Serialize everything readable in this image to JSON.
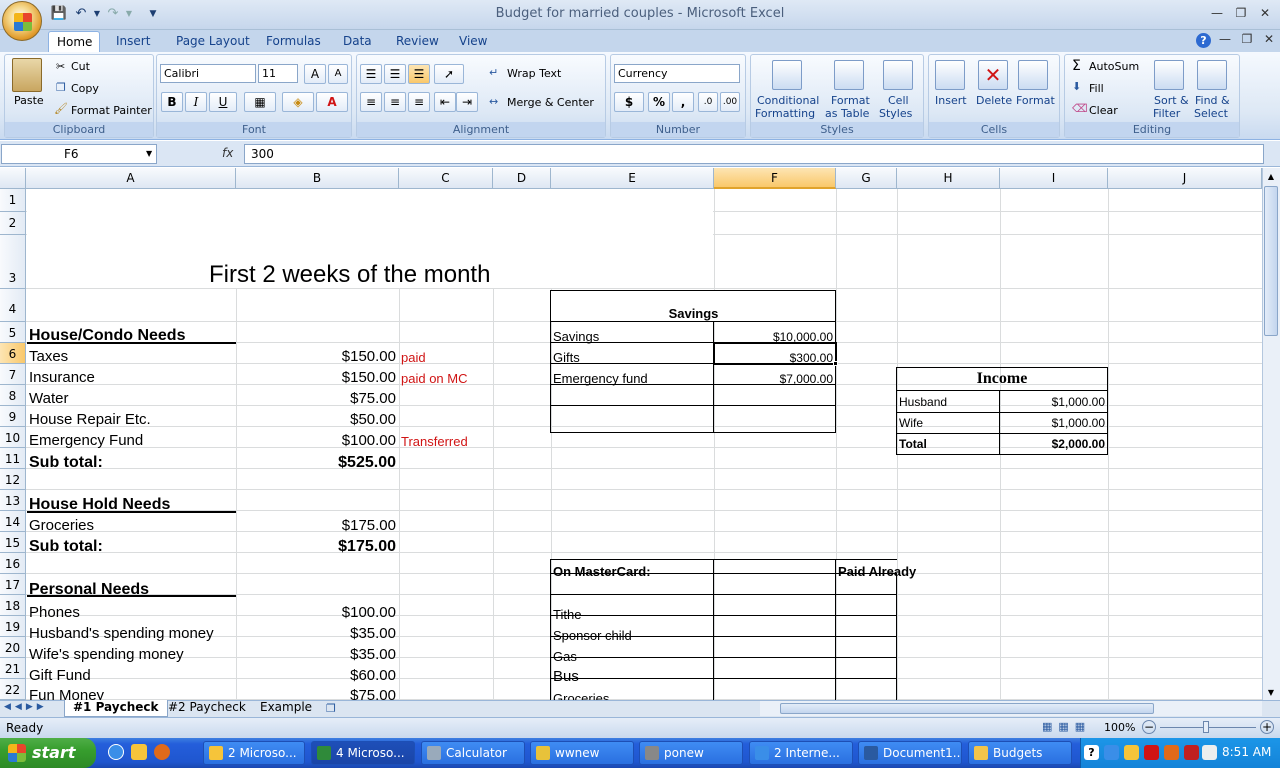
{
  "window": {
    "title": "Budget for married couples - Microsoft Excel"
  },
  "ribbon": {
    "tabs": [
      "Home",
      "Insert",
      "Page Layout",
      "Formulas",
      "Data",
      "Review",
      "View"
    ],
    "clipboard": {
      "paste": "Paste",
      "cut": "Cut",
      "copy": "Copy",
      "format_painter": "Format Painter",
      "label": "Clipboard"
    },
    "font": {
      "name": "Calibri",
      "size": "11",
      "label": "Font",
      "bold": "B",
      "italic": "I",
      "underline": "U"
    },
    "alignment": {
      "wrap": "Wrap Text",
      "merge": "Merge & Center",
      "label": "Alignment"
    },
    "number": {
      "format": "Currency",
      "label": "Number",
      "dollar": "$",
      "percent": "%",
      "comma": ","
    },
    "styles": {
      "conditional": "Conditional",
      "conditional2": "Formatting",
      "format_table": "Format",
      "format_table2": "as Table",
      "cell_styles": "Cell",
      "cell_styles2": "Styles",
      "label": "Styles"
    },
    "cells": {
      "insert": "Insert",
      "delete": "Delete",
      "format": "Format",
      "label": "Cells"
    },
    "editing": {
      "autosum": "AutoSum",
      "fill": "Fill",
      "clear": "Clear",
      "sort": "Sort &",
      "sort2": "Filter",
      "find": "Find &",
      "find2": "Select",
      "label": "Editing"
    }
  },
  "formula_bar": {
    "name_box": "F6",
    "fx": "fx",
    "formula": "300"
  },
  "columns": [
    "A",
    "B",
    "C",
    "D",
    "E",
    "F",
    "G",
    "H",
    "I",
    "J"
  ],
  "rows": [
    "1",
    "2",
    "3",
    "4",
    "5",
    "6",
    "7",
    "8",
    "9",
    "10",
    "11",
    "12",
    "13",
    "14",
    "15",
    "16",
    "17",
    "18",
    "19",
    "20",
    "21",
    "22"
  ],
  "sheet": {
    "heading": "First 2 weeks of the month",
    "house": {
      "title": "House/Condo Needs",
      "items": [
        {
          "label": "Taxes",
          "amount": "$150.00",
          "note": "paid"
        },
        {
          "label": "Insurance",
          "amount": "$150.00",
          "note": "paid on MC"
        },
        {
          "label": "Water",
          "amount": "$75.00",
          "note": ""
        },
        {
          "label": "House Repair Etc.",
          "amount": "$50.00",
          "note": ""
        },
        {
          "label": "Emergency Fund",
          "amount": "$100.00",
          "note": "Transferred"
        }
      ],
      "subtotal_label": "Sub total:",
      "subtotal": "$525.00"
    },
    "household": {
      "title": "House Hold Needs",
      "items": [
        {
          "label": "Groceries",
          "amount": "$175.00"
        }
      ],
      "subtotal_label": "Sub total:",
      "subtotal": "$175.00"
    },
    "personal": {
      "title": "Personal Needs",
      "items": [
        {
          "label": "Phones",
          "amount": "$100.00"
        },
        {
          "label": "Husband's spending money",
          "amount": "$35.00"
        },
        {
          "label": "Wife's spending money",
          "amount": "$35.00"
        },
        {
          "label": "Gift Fund",
          "amount": "$60.00"
        },
        {
          "label": "Fun Money",
          "amount": "$75.00"
        }
      ]
    },
    "savings": {
      "title": "Savings",
      "items": [
        {
          "label": "Savings",
          "amount": "$10,000.00"
        },
        {
          "label": "Gifts",
          "amount": "$300.00"
        },
        {
          "label": "Emergency fund",
          "amount": "$7,000.00"
        }
      ]
    },
    "income": {
      "title": "Income",
      "items": [
        {
          "label": "Husband",
          "amount": "$1,000.00"
        },
        {
          "label": "Wife",
          "amount": "$1,000.00"
        }
      ],
      "total_label": "Total",
      "total": "$2,000.00"
    },
    "mastercard": {
      "title": "On MasterCard:",
      "paid_label": "Paid Already",
      "items": [
        "Tithe",
        "Sponsor child",
        "Gas",
        "Bus",
        "Groceries"
      ]
    }
  },
  "sheet_tabs": [
    "#1 Paycheck",
    "#2 Paycheck",
    "Example"
  ],
  "status": {
    "ready": "Ready",
    "zoom": "100%"
  },
  "taskbar": {
    "start": "start",
    "tasks": [
      "2 Microso...",
      "4 Microso...",
      "Calculator",
      "wwnew",
      "ponew",
      "2 Interne...",
      "Document1...",
      "Budgets"
    ],
    "clock": "8:51 AM"
  },
  "colors": {
    "selected_header": "#f9c86b",
    "red_note": "#d01414",
    "taskbar": "#245edb"
  }
}
